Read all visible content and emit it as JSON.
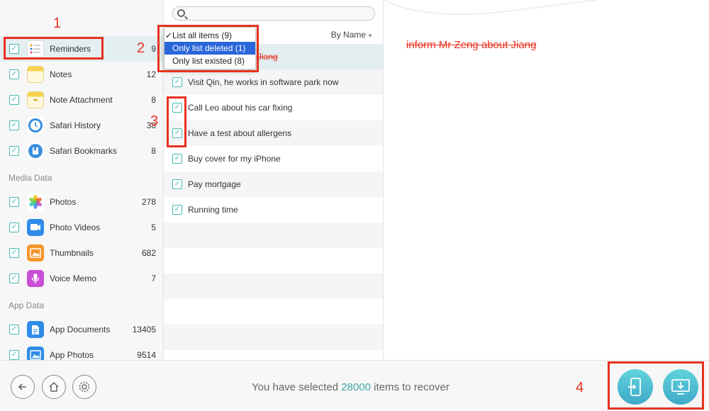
{
  "window": {
    "close": "×",
    "minimize": "−",
    "maximize": "+"
  },
  "sidebar": {
    "items": [
      {
        "label": "Reminders",
        "count": "9",
        "active": true
      },
      {
        "label": "Notes",
        "count": "12"
      },
      {
        "label": "Note Attachment",
        "count": "8"
      },
      {
        "label": "Safari History",
        "count": "38"
      },
      {
        "label": "Safari Bookmarks",
        "count": "8"
      }
    ],
    "media_section": "Media Data",
    "media_items": [
      {
        "label": "Photos",
        "count": "278"
      },
      {
        "label": "Photo Videos",
        "count": "5"
      },
      {
        "label": "Thumbnails",
        "count": "682"
      },
      {
        "label": "Voice Memo",
        "count": "7"
      }
    ],
    "app_section": "App Data",
    "app_items": [
      {
        "label": "App Documents",
        "count": "13405"
      },
      {
        "label": "App Photos",
        "count": "9514"
      }
    ]
  },
  "list": {
    "search_placeholder": "",
    "sort_label": "By Name",
    "rows": [
      {
        "text": "out Jiang",
        "deleted": true
      },
      {
        "text": "Visit Qin, he works in software park now"
      },
      {
        "text": "Call Leo about his car fixing"
      },
      {
        "text": "Have a test about allergens"
      },
      {
        "text": "Buy cover for my iPhone"
      },
      {
        "text": "Pay mortgage"
      },
      {
        "text": "Running time"
      }
    ]
  },
  "dropdown": {
    "options": [
      {
        "label": "List all items (9)",
        "checked": true
      },
      {
        "label": "Only list deleted (1)",
        "selected": true
      },
      {
        "label": "Only list existed (8)"
      }
    ]
  },
  "detail": {
    "title": "inform Mr Zeng about Jiang"
  },
  "bottom": {
    "status_prefix": "You have selected",
    "status_count": "28000",
    "status_suffix": "items to recover"
  },
  "annotations": {
    "n1": "1",
    "n2": "2",
    "n3": "3",
    "n4": "4"
  },
  "colors": {
    "accent": "#46b9b2",
    "deleted": "#e8321f",
    "annotation": "#e8321f",
    "selection": "#2a66d9"
  }
}
